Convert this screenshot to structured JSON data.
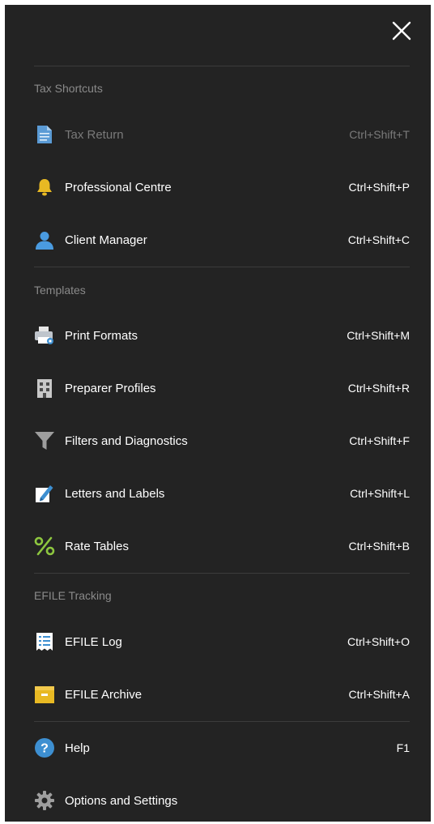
{
  "sections": {
    "tax_shortcuts": {
      "header": "Tax Shortcuts",
      "items": [
        {
          "label": "Tax Return",
          "shortcut": "Ctrl+Shift+T",
          "icon": "document-icon",
          "disabled": true
        },
        {
          "label": "Professional Centre",
          "shortcut": "Ctrl+Shift+P",
          "icon": "bell-icon"
        },
        {
          "label": "Client Manager",
          "shortcut": "Ctrl+Shift+C",
          "icon": "person-icon"
        }
      ]
    },
    "templates": {
      "header": "Templates",
      "items": [
        {
          "label": "Print Formats",
          "shortcut": "Ctrl+Shift+M",
          "icon": "printer-icon"
        },
        {
          "label": "Preparer Profiles",
          "shortcut": "Ctrl+Shift+R",
          "icon": "building-icon"
        },
        {
          "label": "Filters and Diagnostics",
          "shortcut": "Ctrl+Shift+F",
          "icon": "funnel-icon"
        },
        {
          "label": "Letters and Labels",
          "shortcut": "Ctrl+Shift+L",
          "icon": "pen-icon"
        },
        {
          "label": "Rate Tables",
          "shortcut": "Ctrl+Shift+B",
          "icon": "percent-icon"
        }
      ]
    },
    "efile": {
      "header": "EFILE Tracking",
      "items": [
        {
          "label": "EFILE Log",
          "shortcut": "Ctrl+Shift+O",
          "icon": "receipt-icon"
        },
        {
          "label": "EFILE Archive",
          "shortcut": "Ctrl+Shift+A",
          "icon": "archive-box-icon"
        }
      ]
    },
    "footer": {
      "items": [
        {
          "label": "Help",
          "shortcut": "F1",
          "icon": "help-circle-icon"
        },
        {
          "label": "Options and Settings",
          "shortcut": "",
          "icon": "gear-icon"
        }
      ]
    }
  },
  "colors": {
    "background": "#232323",
    "text": "#ffffff",
    "muted_text": "#8a8a8a",
    "divider": "#3c3c3c",
    "accent_blue": "#3d8fd1",
    "accent_yellow": "#e8b923",
    "accent_green": "#8dc63f"
  }
}
